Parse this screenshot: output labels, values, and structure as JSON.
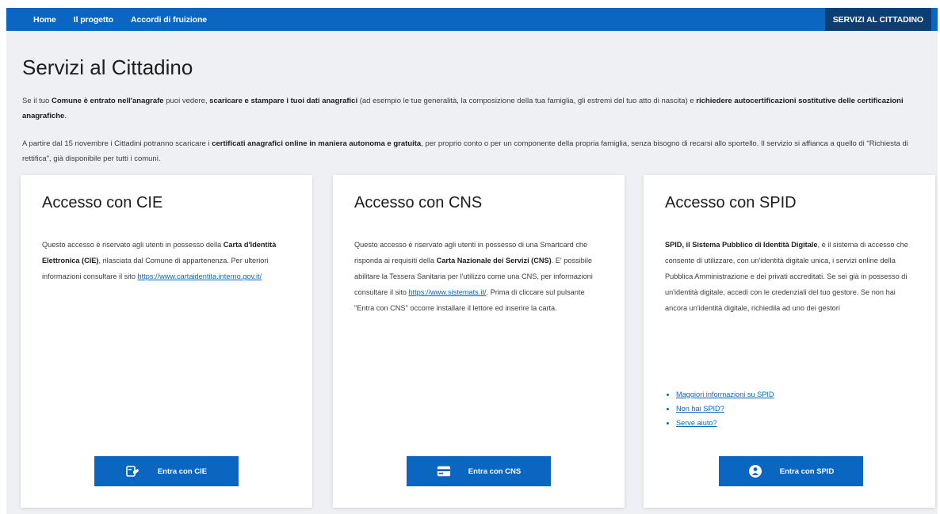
{
  "nav": {
    "items": [
      "Home",
      "Il progetto",
      "Accordi di fruizione"
    ],
    "right_button": "SERVIZI AL CITTADINO"
  },
  "page": {
    "title": "Servizi al Cittadino",
    "intro1": {
      "t1": "Se il tuo ",
      "b1": "Comune è entrato nell'anagrafe",
      "t2": " puoi vedere, ",
      "b2": "scaricare e stampare i tuoi dati anagrafici",
      "t3": " (ad esempio le tue generalità, la composizione della tua famiglia, gli estremi del tuo atto di nascita) e ",
      "b3": "richiedere autocertificazioni sostitutive delle certificazioni anagrafiche",
      "t4": "."
    },
    "intro2": {
      "t1": "A partire dal 15 novembre i Cittadini potranno scaricare i ",
      "b1": "certificati anagrafici online in maniera autonoma e gratuita",
      "t2": ", per proprio conto o per un componente della propria famiglia, senza bisogno di recarsi allo sportello. Il servizio si affianca a quello di \"Richiesta di rettifica\", già disponibile per tutti i comuni."
    }
  },
  "cards": {
    "cie": {
      "title": "Accesso con CIE",
      "t1": "Questo accesso è riservato agli utenti in possesso della ",
      "b1": "Carta d'Identità Elettronica (CIE)",
      "t2": ", rilasciata dal Comune di appartenenza. Per ulteriori informazioni consultare il sito ",
      "link": "https://www.cartaidentita.interno.gov.it/",
      "button": "Entra con CIE"
    },
    "cns": {
      "title": "Accesso con CNS",
      "t1": "Questo accesso è riservato agli utenti in possesso di una Smartcard che risponda ai requisiti della ",
      "b1": "Carta Nazionale dei Servizi (CNS)",
      "t2": ". E' possibile abilitare la Tessera Sanitaria per l'utilizzo come una CNS, per informazioni consultare il sito ",
      "link": "https://www.sistemats.it/",
      "t3": ". Prima di cliccare sul pulsante \"Entra con CNS\" occorre installare il lettore ed inserire la carta.",
      "button": "Entra con CNS"
    },
    "spid": {
      "title": "Accesso con SPID",
      "b1": "SPID, il Sistema Pubblico di Identità Digitale",
      "t1": ", è il sistema di accesso che consente di utilizzare, con un'identità digitale unica, i servizi online della Pubblica Amministrazione e dei privati accreditati. Se sei già in possesso di un'identità digitale, accedi con le credenziali del tuo gestore. Se non hai ancora un'identità digitale, richiedila ad uno dei gestori",
      "links": [
        "Maggiori informazioni su SPID",
        "Non hai SPID?",
        "Serve aiuto?"
      ],
      "button": "Entra con SPID"
    }
  },
  "icons": {
    "cie": "cie-card-hand-icon",
    "cns": "smartcard-icon",
    "spid": "spid-user-icon"
  },
  "colors": {
    "primary": "#0b66c2",
    "nav_dark": "#0d3e73",
    "background": "#eef0f3"
  }
}
